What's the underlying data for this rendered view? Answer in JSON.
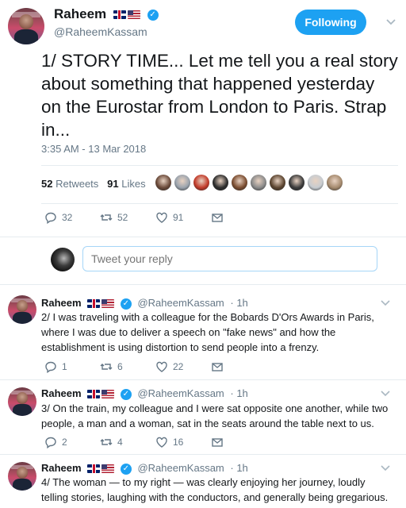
{
  "main": {
    "name": "Raheem",
    "handle": "@RaheemKassam",
    "follow_label": "Following",
    "text": "1/ STORY TIME... Let me tell you a real story about something that happened yesterday on the Eurostar from London to Paris. Strap in...",
    "timestamp": "3:35 AM - 13 Mar 2018",
    "retweets_count": "52",
    "retweets_label": "Retweets",
    "likes_count": "91",
    "likes_label": "Likes",
    "actions": {
      "reply": "32",
      "retweet": "52",
      "like": "91"
    },
    "liker_colors": [
      "#6b4a3a",
      "#9aa3ad",
      "#c23b2a",
      "#2d2d2d",
      "#7b4d30",
      "#8a8a8a",
      "#5c4530",
      "#3b3b3b",
      "#c7ccd1",
      "#a58a6e"
    ]
  },
  "reply_box": {
    "placeholder": "Tweet your reply"
  },
  "thread": [
    {
      "name": "Raheem",
      "handle": "@RaheemKassam",
      "time": "· 1h",
      "text": "2/ I was traveling with a colleague for the Bobards D'Ors Awards in Paris, where I was due to deliver a speech on \"fake news\" and how the establishment is using distortion to send people into a frenzy.",
      "replies": "1",
      "retweets": "6",
      "likes": "22"
    },
    {
      "name": "Raheem",
      "handle": "@RaheemKassam",
      "time": "· 1h",
      "text": "3/ On the train, my colleague and I were sat opposite one another, while two people, a man and a woman, sat in the seats around the table next to us.",
      "replies": "2",
      "retweets": "4",
      "likes": "16"
    },
    {
      "name": "Raheem",
      "handle": "@RaheemKassam",
      "time": "· 1h",
      "text": "4/ The woman — to my right — was clearly enjoying her journey, loudly telling stories, laughing with the conductors, and generally being gregarious."
    }
  ],
  "colors": {
    "accent": "#1da1f2",
    "muted": "#657786",
    "text": "#14171a",
    "divider": "#e6ecf0"
  }
}
